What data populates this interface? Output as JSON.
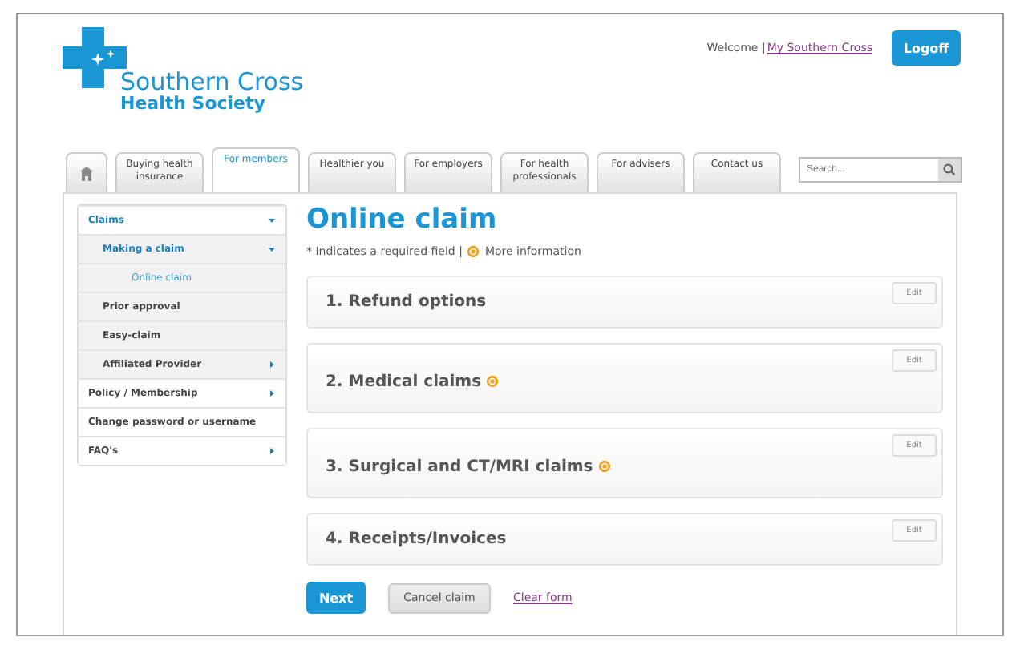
{
  "header": {
    "logo_line1": "Southern Cross",
    "logo_line2": "Health Society",
    "welcome": "Welcome |",
    "account_link": "My Southern Cross",
    "logoff": "Logoff"
  },
  "tabs": [
    {
      "kind": "home",
      "selected": false
    },
    {
      "kind": "text",
      "label": "Buying health insurance",
      "selected": false
    },
    {
      "kind": "text",
      "label": "For members",
      "selected": true
    },
    {
      "kind": "text",
      "label": "Healthier you",
      "selected": false
    },
    {
      "kind": "text",
      "label": "For employers",
      "selected": false
    },
    {
      "kind": "text",
      "label": "For health professionals",
      "selected": false
    },
    {
      "kind": "text",
      "label": "For advisers",
      "selected": false
    },
    {
      "kind": "text",
      "label": "Contact us",
      "selected": false
    }
  ],
  "search": {
    "placeholder": "Search..."
  },
  "sidebar": {
    "items": [
      {
        "label": "Claims",
        "kind": "branch",
        "expanded": true,
        "selected": false,
        "children": [
          {
            "label": "Making a claim",
            "kind": "branch",
            "expanded": true,
            "selected": false,
            "children": [
              {
                "label": "Online claim",
                "kind": "leaf",
                "selected": true
              }
            ]
          },
          {
            "label": "Prior approval",
            "kind": "leaf",
            "selected": false
          },
          {
            "label": "Easy-claim",
            "kind": "leaf",
            "selected": false
          },
          {
            "label": "Affiliated Provider",
            "kind": "branch",
            "expanded": false,
            "selected": false
          }
        ]
      },
      {
        "label": "Policy / Membership",
        "kind": "branch",
        "expanded": false,
        "selected": false
      },
      {
        "label": "Change password or username",
        "kind": "leaf",
        "selected": false
      },
      {
        "label": "FAQ's",
        "kind": "branch",
        "expanded": false,
        "selected": false
      }
    ]
  },
  "main": {
    "title": "Online claim",
    "note": "* Indicates a required field |",
    "info_label": "More information",
    "sections": [
      {
        "title": "1. Refund options",
        "info": false,
        "edit": "Edit"
      },
      {
        "title": "2. Medical claims",
        "info": true,
        "edit": "Edit"
      },
      {
        "title": "3. Surgical and CT/MRI claims",
        "info": true,
        "edit": "Edit"
      },
      {
        "title": "4. Receipts/Invoices",
        "info": false,
        "edit": "Edit"
      }
    ],
    "buttons": {
      "next": "Next",
      "cancel": "Cancel claim",
      "clear": "Clear form"
    }
  }
}
